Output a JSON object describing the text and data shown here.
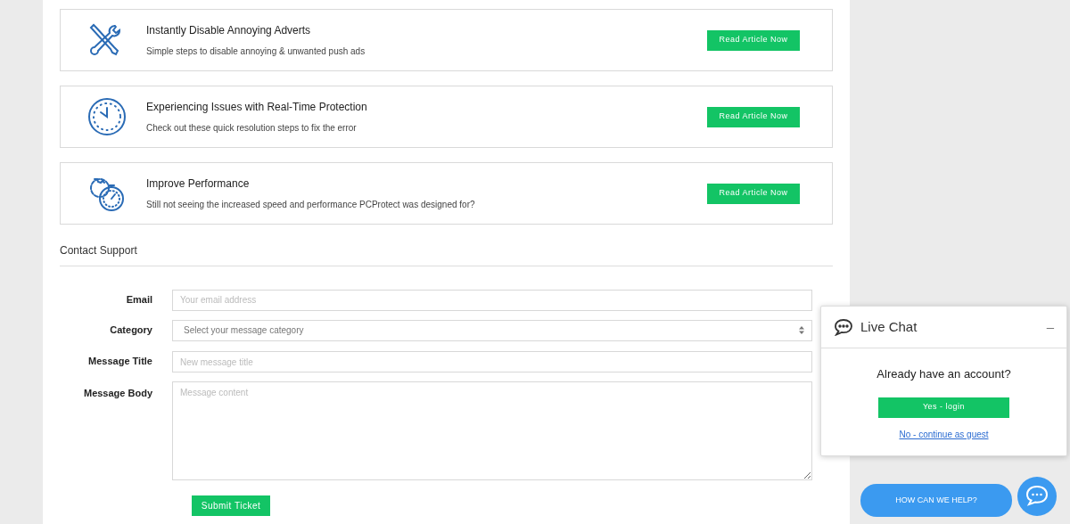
{
  "articles": [
    {
      "kind": "tools",
      "title": "Instantly Disable Annoying Adverts",
      "description": "Simple steps to disable annoying & unwanted push ads",
      "button": "Read Article Now"
    },
    {
      "kind": "clock",
      "title": "Experiencing Issues with Real-Time Protection",
      "description": "Check out these quick resolution steps to fix the error",
      "button": "Read Article Now"
    },
    {
      "kind": "performance",
      "title": "Improve Performance",
      "description": "Still not seeing the increased speed and performance PCProtect was designed for?",
      "button": "Read Article Now"
    }
  ],
  "contact": {
    "title": "Contact Support",
    "fields": [
      {
        "kind": "input",
        "label": "Email",
        "placeholder": "Your email address"
      },
      {
        "kind": "select",
        "label": "Category",
        "placeholder": "Select your message category"
      },
      {
        "kind": "input",
        "label": "Message Title",
        "placeholder": "New message title"
      },
      {
        "kind": "textarea",
        "label": "Message Body",
        "placeholder": "Message content"
      }
    ],
    "submit": "Submit Ticket"
  },
  "live_chat": {
    "title": "Live Chat",
    "minimize": "–",
    "question": "Already have an account?",
    "login": "Yes - login",
    "guest": "No - continue as guest"
  },
  "help_bubble": "HOW CAN WE HELP?"
}
